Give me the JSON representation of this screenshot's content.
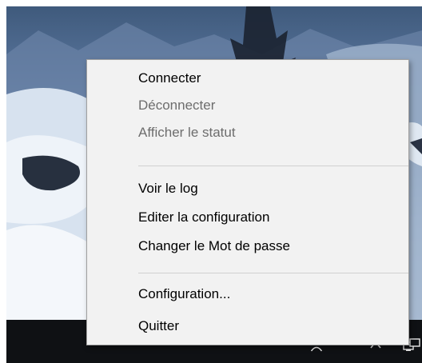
{
  "menu": {
    "items": [
      {
        "label": "Connecter",
        "enabled": true
      },
      {
        "label": "Déconnecter",
        "enabled": false
      },
      {
        "label": "Afficher le statut",
        "enabled": false
      },
      {
        "label": "Voir le log",
        "enabled": true
      },
      {
        "label": "Editer la configuration",
        "enabled": true
      },
      {
        "label": "Changer le Mot de passe",
        "enabled": true
      },
      {
        "label": "Configuration...",
        "enabled": true
      },
      {
        "label": "Quitter",
        "enabled": true
      }
    ]
  },
  "taskbar": {
    "tray_icons": [
      "person-icon",
      "chevron-up-icon",
      "vpn-network-icon"
    ]
  },
  "colors": {
    "menu_background": "#f2f2f2",
    "menu_border": "#a0a0a0",
    "disabled_text": "#6d6d6d",
    "taskbar": "#0f1114"
  }
}
